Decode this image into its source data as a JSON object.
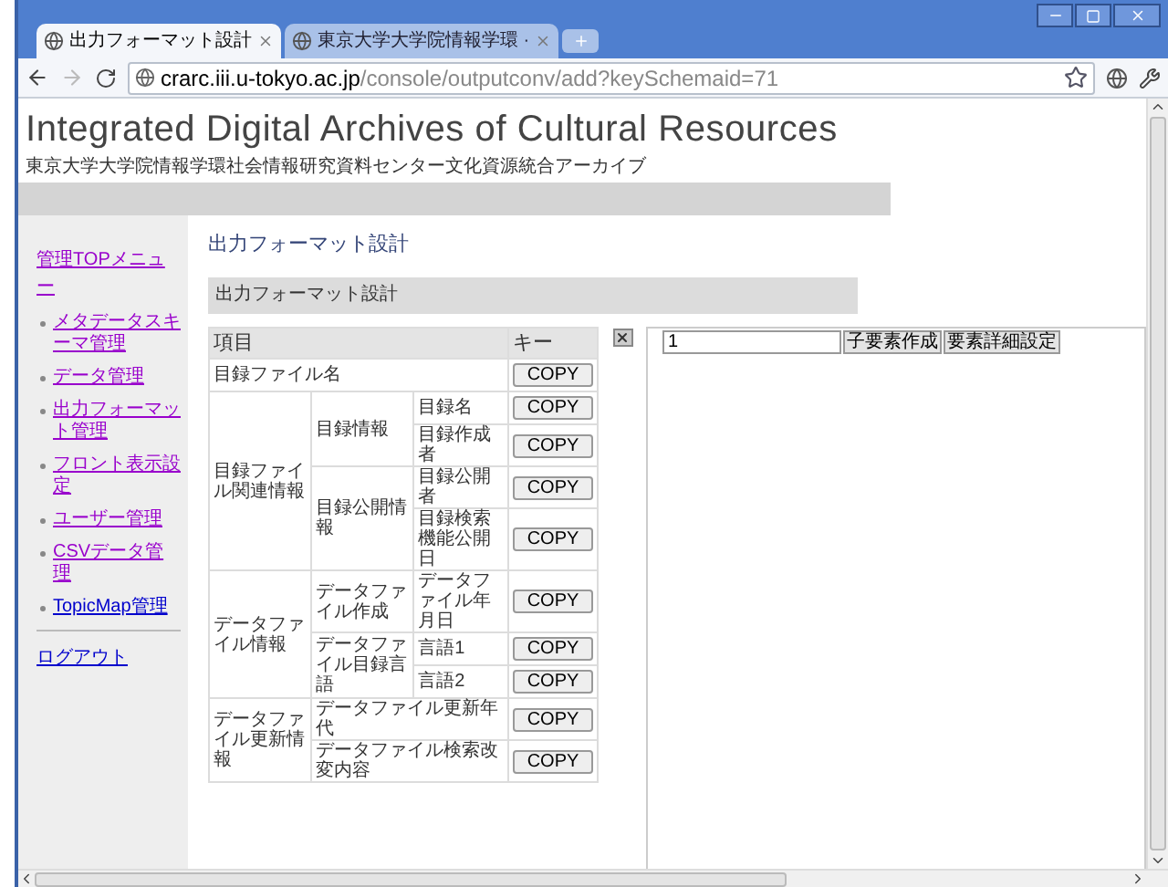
{
  "browser": {
    "tabs": [
      {
        "title": "出力フォーマット設計",
        "selected": true
      },
      {
        "title": "東京大学大学院情報学環 ·",
        "selected": false
      }
    ],
    "url": {
      "host": "crarc.iii.u-tokyo.ac.jp",
      "path": "/console/outputconv/add?keySchemaid=71"
    }
  },
  "site": {
    "title": "Integrated Digital Archives of Cultural Resources",
    "subtitle": "東京大学大学院情報学環社会情報研究資料センター文化資源統合アーカイブ"
  },
  "sidebar": {
    "heading": "管理TOPメニュー",
    "items": [
      "メタデータスキーマ管理",
      "データ管理",
      "出力フォーマット管理",
      "フロント表示設定",
      "ユーザー管理",
      "CSVデータ管理",
      "TopicMap管理"
    ],
    "logout": "ログアウト"
  },
  "main": {
    "heading": "出力フォーマット設計",
    "section_title": "出力フォーマット設計",
    "table": {
      "columns": [
        "項目",
        "キー"
      ],
      "items": [
        {
          "label": "目録ファイル名",
          "button": "COPY"
        },
        {
          "label": "目録ファイル関連情報",
          "children": [
            {
              "label": "目録情報",
              "children": [
                {
                  "label": "目録名",
                  "button": "COPY"
                },
                {
                  "label": "目録作成者",
                  "button": "COPY"
                }
              ]
            },
            {
              "label": "目録公開情報",
              "children": [
                {
                  "label": "目録公開者",
                  "button": "COPY"
                },
                {
                  "label": "目録検索機能公開日",
                  "button": "COPY"
                }
              ]
            }
          ]
        },
        {
          "label": "データファイル情報",
          "children": [
            {
              "label": "データファイル作成",
              "children": [
                {
                  "label": "データファイル年月日",
                  "button": "COPY"
                }
              ]
            },
            {
              "label": "データファイル目録言語",
              "children": [
                {
                  "label": "言語1",
                  "button": "COPY"
                },
                {
                  "label": "言語2",
                  "button": "COPY"
                }
              ]
            }
          ]
        },
        {
          "label": "データファイル更新情報",
          "children": [
            {
              "label": "データファイル更新年代",
              "button": "COPY"
            },
            {
              "label": "データファイル検索改変内容",
              "button": "COPY"
            }
          ]
        }
      ]
    },
    "editor": {
      "input_value": "1",
      "buttons": [
        "子要素作成",
        "要素詳細設定"
      ]
    }
  }
}
